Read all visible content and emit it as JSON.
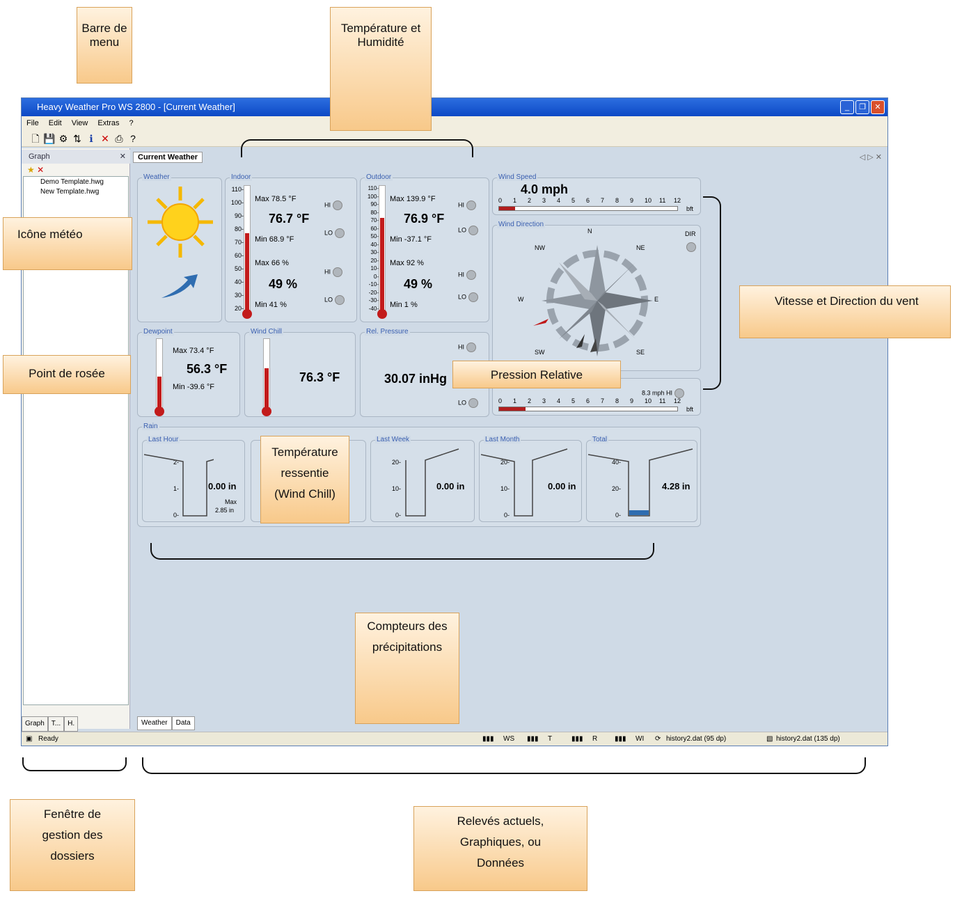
{
  "window": {
    "title": "Heavy Weather Pro WS 2800 - [Current Weather]"
  },
  "menu": [
    "File",
    "Edit",
    "View",
    "Extras",
    "?"
  ],
  "left": {
    "header": "Graph",
    "files": [
      "Demo Template.hwg",
      "New Template.hwg"
    ],
    "tabs": [
      "Graph",
      "T...",
      "H."
    ]
  },
  "tab": "Current Weather",
  "bottom_tabs": [
    "Weather",
    "Data"
  ],
  "status": {
    "ready": "Ready",
    "items": [
      "WS",
      "T",
      "R",
      "WI"
    ],
    "file1": "history2.dat (95 dp)",
    "file2": "history2.dat (135 dp)"
  },
  "panels": {
    "weather": "Weather",
    "indoor": {
      "title": "Indoor",
      "ticks": [
        "110-",
        "100-",
        "90-",
        "80-",
        "70-",
        "60-",
        "50-",
        "40-",
        "30-",
        "20-"
      ],
      "tmax": "Max 78.5 °F",
      "temp": "76.7 °F",
      "tmin": "Min 68.9 °F",
      "hmax": "Max 66 %",
      "hum": "49 %",
      "hmin": "Min 41 %"
    },
    "outdoor": {
      "title": "Outdoor",
      "ticks": [
        "110-",
        "100-",
        "90-",
        "80-",
        "70-",
        "60-",
        "50-",
        "40-",
        "30-",
        "20-",
        "10-",
        "0-",
        "-10-",
        "-20-",
        "-30-",
        "-40-"
      ],
      "tmax": "Max 139.9 °F",
      "temp": "76.9 °F",
      "tmin": "Min -37.1 °F",
      "hmax": "Max 92 %",
      "hum": "49 %",
      "hmin": "Min 1 %"
    },
    "wind_speed": {
      "title": "Wind Speed",
      "value": "4.0 mph",
      "unit": "bft",
      "scale": [
        "0",
        "1",
        "2",
        "3",
        "4",
        "5",
        "6",
        "7",
        "8",
        "9",
        "10",
        "11",
        "12"
      ],
      "level": 0.09
    },
    "wind_dir": {
      "title": "Wind Direction",
      "dir": "DIR",
      "compass": [
        "N",
        "NE",
        "E",
        "SE",
        "S",
        "SW",
        "W",
        "NW"
      ]
    },
    "gust": {
      "hi": "8.3 mph",
      "hi_label": "HI",
      "unit": "bft",
      "level": 0.15
    },
    "dewpoint": {
      "title": "Dewpoint",
      "max": "Max 73.4 °F",
      "value": "56.3 °F",
      "min": "Min -39.6 °F"
    },
    "windchill": {
      "title": "Wind Chill",
      "value": "76.3 °F"
    },
    "pressure": {
      "title": "Rel. Pressure",
      "value": "30.07 inHg"
    },
    "rain": {
      "title": "Rain",
      "cells": [
        {
          "title": "Last Hour",
          "ticks": [
            "2-",
            "1-",
            "0-"
          ],
          "value": "0.00 in",
          "max": "Max",
          "maxval": "2.85 in"
        },
        {
          "title": "Last Week",
          "ticks": [
            "20-",
            "10-",
            "0-"
          ],
          "value": "0.00 in"
        },
        {
          "title": "Last Month",
          "ticks": [
            "20-",
            "10-",
            "0-"
          ],
          "value": "0.00 in"
        },
        {
          "title": "Total",
          "ticks": [
            "40-",
            "20-",
            "0-"
          ],
          "value": "4.28 in"
        }
      ]
    },
    "hi": "HI",
    "lo": "LO"
  },
  "annotations": {
    "menu": "Barre de menu",
    "temp_hum": "Température et Humidité",
    "icon": "Icône météo",
    "wind": "Vitesse et Direction du vent",
    "dew": "Point de rosée",
    "pressure": "Pression Relative",
    "windchill": "Température ressentie (Wind Chill)",
    "rain": "Compteurs des précipitations",
    "folders": "Fenêtre de gestion des dossiers",
    "readings": "Relevés actuels, Graphiques, ou Données"
  }
}
